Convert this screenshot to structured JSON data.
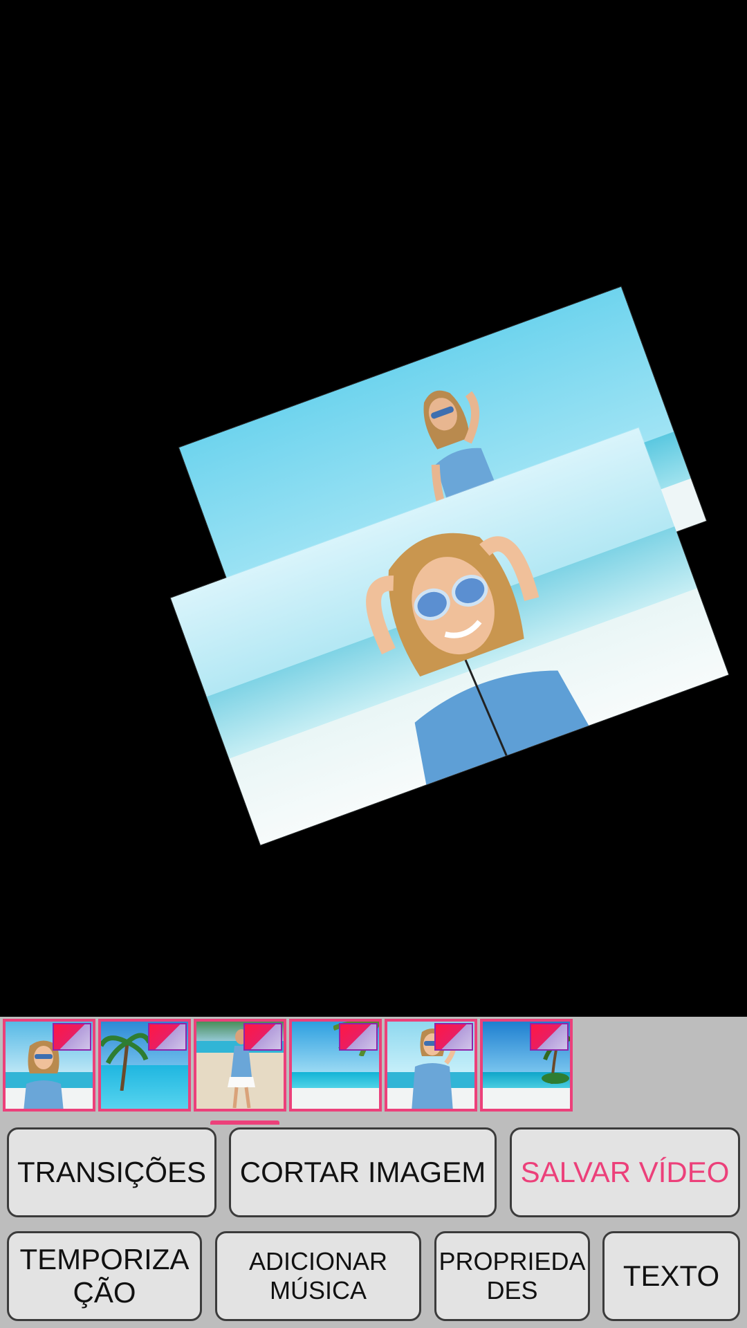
{
  "preview": {
    "photos": [
      {
        "name": "beach-woman-sunglasses-standing"
      },
      {
        "name": "beach-woman-sunglasses-closeup"
      }
    ]
  },
  "thumbnails": [
    {
      "label": "beach-woman-portrait",
      "corner_icon": "page-corner-icon"
    },
    {
      "label": "palm-tree-sea",
      "corner_icon": "page-corner-icon"
    },
    {
      "label": "woman-walking-beach",
      "corner_icon": "page-corner-icon"
    },
    {
      "label": "tropical-sea-palm",
      "corner_icon": "page-corner-icon"
    },
    {
      "label": "beach-woman-hand-on-head",
      "corner_icon": "page-corner-icon"
    },
    {
      "label": "island-beach-palm",
      "corner_icon": "page-corner-icon"
    }
  ],
  "buttons": {
    "transitions": "TRANSIÇÕES",
    "crop": "CORTAR IMAGEM",
    "save": "SALVAR VÍDEO",
    "timing_line1": "TEMPORIZA",
    "timing_line2": "ÇÃO",
    "music_line1": "ADICIONAR",
    "music_line2": "MÚSICA",
    "properties_line1": "PROPRIEDA",
    "properties_line2": "DES",
    "text": "TEXTO"
  },
  "colors": {
    "accent": "#ec407a",
    "panel": "#bdbdbd",
    "button_bg": "#e3e3e3",
    "button_border": "#3b3b3b"
  }
}
